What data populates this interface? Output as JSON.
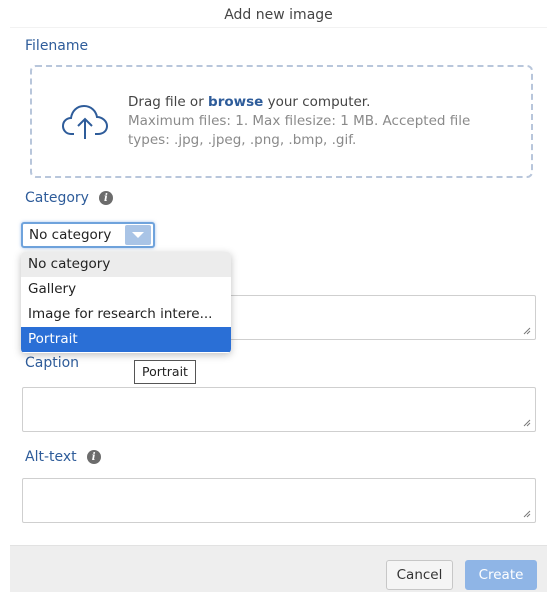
{
  "dialog": {
    "title": "Add new image"
  },
  "filename": {
    "label": "Filename",
    "dropzone": {
      "prefix": "Drag file or ",
      "browse": "browse",
      "suffix": " your computer.",
      "limits": "Maximum files: 1. Max filesize: 1 MB. Accepted file types: .jpg, .jpeg, .png, .bmp, .gif.",
      "icon": "cloud-upload-icon"
    }
  },
  "category": {
    "label": "Category",
    "selected": "No category",
    "options": [
      "No category",
      "Gallery",
      "Image for research intere...",
      "Portrait"
    ],
    "highlighted": "Portrait",
    "hovered": "No category",
    "tooltip": "Portrait"
  },
  "caption": {
    "label": "Caption",
    "value": ""
  },
  "alt_text": {
    "label": "Alt-text",
    "value": ""
  },
  "footer": {
    "cancel": "Cancel",
    "create": "Create"
  },
  "colors": {
    "accent": "#2e5c9a",
    "highlight": "#2a6fd6",
    "create_button": "#8fb5e6"
  }
}
